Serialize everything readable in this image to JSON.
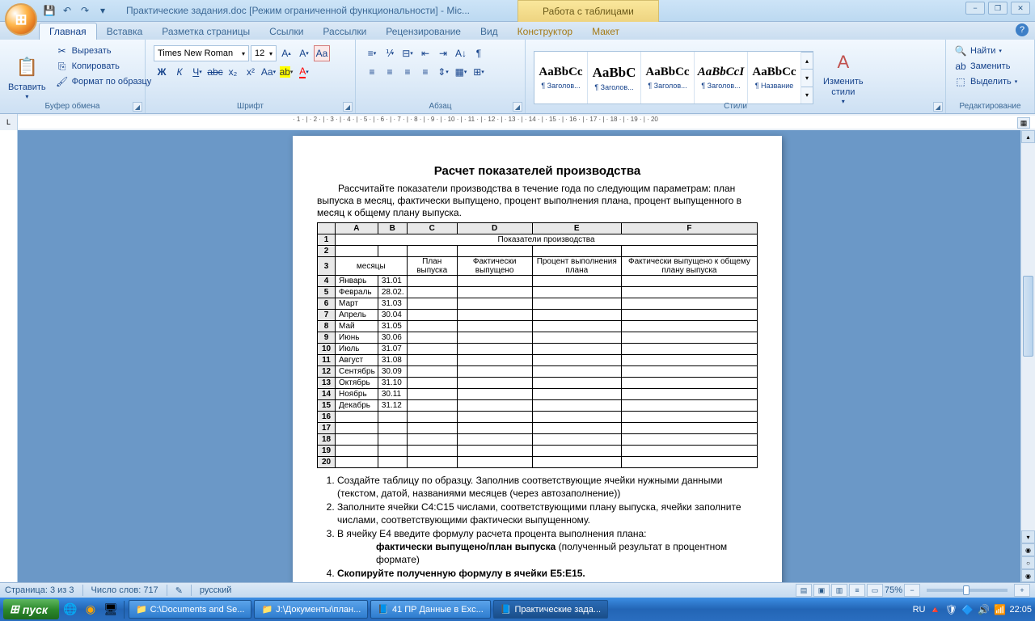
{
  "window": {
    "title": "Практические задания.doc [Режим ограниченной функциональности] - Mic...",
    "contextual_tab": "Работа с таблицами"
  },
  "qat": [
    "save",
    "undo",
    "redo",
    "more"
  ],
  "tabs": {
    "items": [
      "Главная",
      "Вставка",
      "Разметка страницы",
      "Ссылки",
      "Рассылки",
      "Рецензирование",
      "Вид",
      "Конструктор",
      "Макет"
    ],
    "active": 0
  },
  "ribbon": {
    "clipboard": {
      "label": "Буфер обмена",
      "paste": "Вставить",
      "cut": "Вырезать",
      "copy": "Копировать",
      "format_painter": "Формат по образцу"
    },
    "font": {
      "label": "Шрифт",
      "name": "Times New Roman",
      "size": "12"
    },
    "paragraph": {
      "label": "Абзац"
    },
    "styles": {
      "label": "Стили",
      "items": [
        {
          "preview": "AaBbCc",
          "name": "¶ Заголов..."
        },
        {
          "preview": "AaBbC",
          "name": "¶ Заголов..."
        },
        {
          "preview": "AaBbCc",
          "name": "¶ Заголов..."
        },
        {
          "preview": "AaBbCcI",
          "name": "¶ Заголов..."
        },
        {
          "preview": "AaBbCc",
          "name": "¶ Название"
        }
      ],
      "change": "Изменить\nстили"
    },
    "editing": {
      "label": "Редактирование",
      "find": "Найти",
      "replace": "Заменить",
      "select": "Выделить"
    }
  },
  "ruler_h": "· 1 · | · 2 · | · 3 · | · 4 · | · 5 · | · 6 · | · 7 · | · 8 · | · 9 · | · 10 · | · 11 · | · 12 · | · 13 · | · 14 · | · 15 · | · 16 · | · 17 · | · 18 · | · 19 · | · 20",
  "document": {
    "title": "Расчет показателей производства",
    "intro": "Рассчитайте показатели производства в течение года по следующим параметрам: план выпуска в месяц,  фактически выпущено, процент выполнения плана, процент выпущенного в месяц к общему плану выпуска.",
    "columns": [
      "A",
      "B",
      "C",
      "D",
      "E",
      "F"
    ],
    "merged_header": "Показатели производства",
    "headers": [
      "месяцы",
      "",
      "План выпуска",
      "Фактически выпущено",
      "Процент выполнения плана",
      "Фактически выпущено к общему плану выпуска"
    ],
    "rows": [
      {
        "n": "4",
        "a": "Январь",
        "b": "31.01"
      },
      {
        "n": "5",
        "a": "Февраль",
        "b": "28.02."
      },
      {
        "n": "6",
        "a": "Март",
        "b": "31.03"
      },
      {
        "n": "7",
        "a": "Апрель",
        "b": "30.04"
      },
      {
        "n": "8",
        "a": "Май",
        "b": "31.05"
      },
      {
        "n": "9",
        "a": "Июнь",
        "b": "30.06"
      },
      {
        "n": "10",
        "a": "Июль",
        "b": "31.07"
      },
      {
        "n": "11",
        "a": "Август",
        "b": "31.08"
      },
      {
        "n": "12",
        "a": "Сентябрь",
        "b": "30.09"
      },
      {
        "n": "13",
        "a": "Октябрь",
        "b": "31.10"
      },
      {
        "n": "14",
        "a": "Ноябрь",
        "b": "30.11"
      },
      {
        "n": "15",
        "a": "Декабрь",
        "b": "31.12"
      },
      {
        "n": "16",
        "a": "",
        "b": ""
      },
      {
        "n": "17",
        "a": "",
        "b": ""
      },
      {
        "n": "18",
        "a": "",
        "b": ""
      },
      {
        "n": "19",
        "a": "",
        "b": ""
      },
      {
        "n": "20",
        "a": "",
        "b": ""
      }
    ],
    "tasks": [
      "Создайте таблицу по образцу. Заполнив соответствующие ячейки нужными данными (текстом,  датой, названиями месяцев (через автозаполнение))",
      "Заполните  ячейки C4:C15 числами, соответствующими плану выпуска, ячейки заполните числами, соответствующими фактически выпущенному.",
      "В ячейку E4 введите формулу расчета процента выполнения плана:",
      "Скопируйте полученную формулу в ячейки E5:E15."
    ],
    "formula": "фактически выпущено/план выпуска",
    "formula_note": " (полученный результат в процентном формате)"
  },
  "status": {
    "page": "Страница: 3 из 3",
    "words": "Число слов: 717",
    "lang": "русский",
    "zoom": "75%"
  },
  "taskbar": {
    "start": "пуск",
    "items": [
      "C:\\Documents and Se...",
      "J:\\Документы\\план...",
      "41 ПР Данные в Exc...",
      "Практические зада..."
    ],
    "lang": "RU",
    "time": "22:05"
  }
}
